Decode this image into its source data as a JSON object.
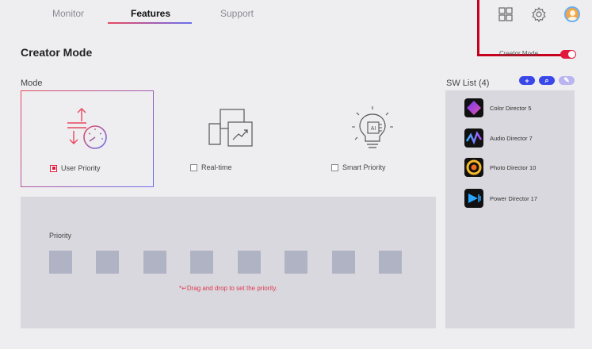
{
  "nav": {
    "tabs": [
      {
        "label": "Monitor"
      },
      {
        "label": "Features"
      },
      {
        "label": "Support"
      }
    ]
  },
  "page": {
    "title": "Creator Mode",
    "toggle_label": "Creator Mode",
    "toggle_on": true
  },
  "mode": {
    "section_label": "Mode",
    "options": [
      {
        "label": "User Priority",
        "checked": true,
        "icon": "user-priority-icon"
      },
      {
        "label": "Real-time",
        "checked": false,
        "icon": "real-time-icon"
      },
      {
        "label": "Smart Priority",
        "checked": false,
        "icon": "smart-priority-icon"
      }
    ]
  },
  "priority": {
    "label": "Priority",
    "hint": "Drag and drop to set the priority.",
    "hint_icon": "*↵",
    "slot_count": 8
  },
  "sw_list": {
    "label": "SW List (4)",
    "actions": [
      {
        "icon": "plus-icon",
        "symbol": "+",
        "color": "#3a47e8"
      },
      {
        "icon": "search-icon",
        "symbol": "⌕",
        "color": "#3a47e8"
      },
      {
        "icon": "pencil-icon",
        "symbol": "✎",
        "color": "#b8b5f0"
      }
    ],
    "apps": [
      {
        "name": "Color Director 5",
        "icon": "color-director-icon"
      },
      {
        "name": "Audio Director 7",
        "icon": "audio-director-icon"
      },
      {
        "name": "Photo Director 10",
        "icon": "photo-director-icon"
      },
      {
        "name": "Power Director 17",
        "icon": "power-director-icon"
      }
    ]
  },
  "colors": {
    "accent_red": "#e11a3c",
    "accent_blue": "#6a6ff0",
    "annotation": "#c7001d"
  }
}
